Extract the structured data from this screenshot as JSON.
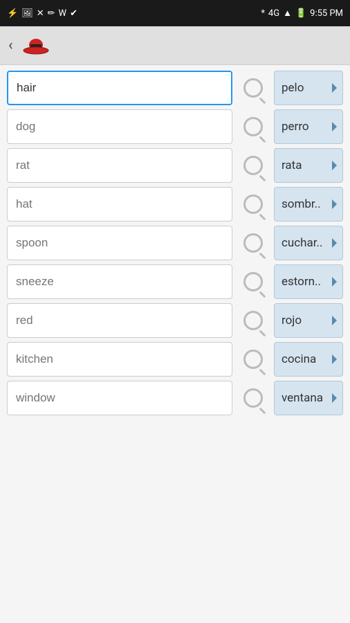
{
  "statusBar": {
    "time": "9:55 PM",
    "icons_left": [
      "usb",
      "image",
      "x",
      "pen",
      "W",
      "check"
    ],
    "icons_right": [
      "bluetooth",
      "4G",
      "signal",
      "battery"
    ]
  },
  "appBar": {
    "backLabel": "‹",
    "logoAlt": "sombrero"
  },
  "vocab": {
    "rows": [
      {
        "english": "hair",
        "englishPlaceholder": "hair",
        "translation": "pelo",
        "translationShort": "pelo",
        "active": true
      },
      {
        "english": "",
        "englishPlaceholder": "dog",
        "translation": "perro",
        "translationShort": "perro",
        "active": false
      },
      {
        "english": "",
        "englishPlaceholder": "rat",
        "translation": "rata",
        "translationShort": "rata",
        "active": false
      },
      {
        "english": "",
        "englishPlaceholder": "hat",
        "translation": "sombr..",
        "translationShort": "sombr..",
        "active": false
      },
      {
        "english": "",
        "englishPlaceholder": "spoon",
        "translation": "cuchar..",
        "translationShort": "cuchar..",
        "active": false
      },
      {
        "english": "",
        "englishPlaceholder": "sneeze",
        "translation": "estorn..",
        "translationShort": "estorn..",
        "active": false
      },
      {
        "english": "",
        "englishPlaceholder": "red",
        "translation": "rojo",
        "translationShort": "rojo",
        "active": false
      },
      {
        "english": "",
        "englishPlaceholder": "kitchen",
        "translation": "cocina",
        "translationShort": "cocina",
        "active": false
      },
      {
        "english": "",
        "englishPlaceholder": "window",
        "translation": "ventana",
        "translationShort": "ventana",
        "active": false
      }
    ]
  }
}
